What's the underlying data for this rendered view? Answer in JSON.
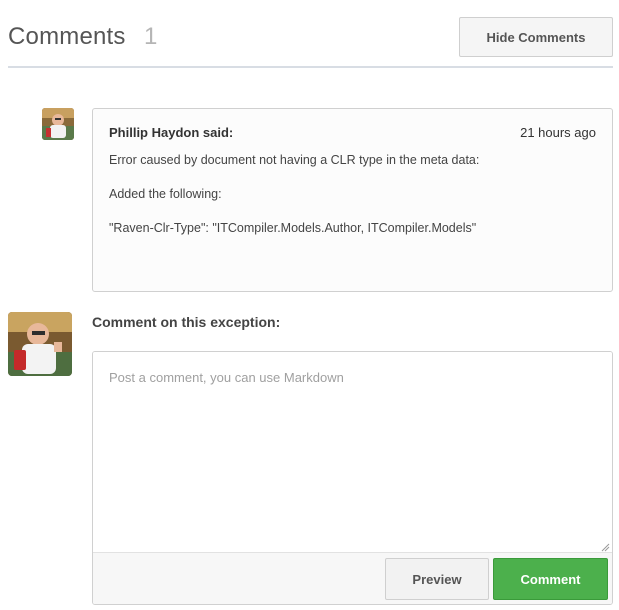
{
  "header": {
    "title": "Comments",
    "count": "1",
    "hide_button": "Hide Comments"
  },
  "comments": [
    {
      "author": "Phillip Haydon said:",
      "time": "21 hours ago",
      "lines": [
        "Error caused by document not having a CLR type in the meta data:",
        "Added the following:",
        "\"Raven-Clr-Type\": \"ITCompiler.Models.Author, ITCompiler.Models\""
      ]
    }
  ],
  "form": {
    "label": "Comment on this exception:",
    "placeholder": "Post a comment, you can use Markdown",
    "value": "",
    "preview_button": "Preview",
    "comment_button": "Comment"
  },
  "colors": {
    "primary_button": "#4cb04c",
    "divider": "#d8dde4"
  }
}
